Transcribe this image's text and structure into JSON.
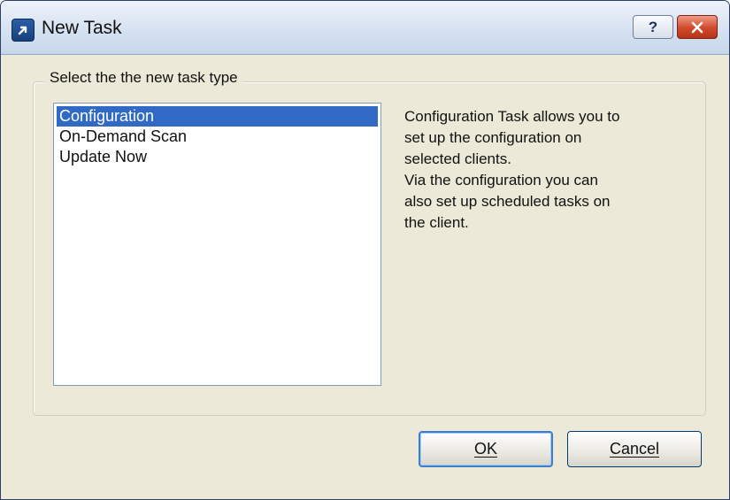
{
  "window": {
    "title": "New Task",
    "help_label": "?",
    "close_label": "×"
  },
  "group": {
    "legend": "Select the the new task type"
  },
  "task_types": [
    {
      "label": "Configuration",
      "selected": true
    },
    {
      "label": "On-Demand Scan",
      "selected": false
    },
    {
      "label": "Update Now",
      "selected": false
    }
  ],
  "description": {
    "lines": [
      "Configuration Task allows you to",
      "set up the configuration on",
      "selected clients.",
      "Via the configuration you can",
      "also set up scheduled tasks on",
      "the client."
    ]
  },
  "buttons": {
    "ok_label": "OK",
    "cancel_label": "Cancel"
  },
  "colors": {
    "selection": "#316ac5",
    "close_button": "#d04a2b"
  }
}
